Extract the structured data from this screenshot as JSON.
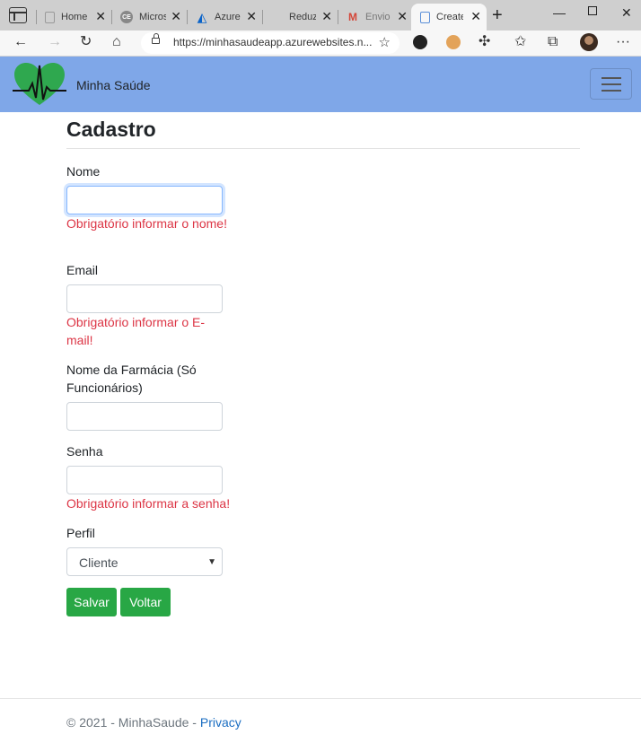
{
  "browser": {
    "tabs": [
      {
        "title": "Home"
      },
      {
        "title": "Micros"
      },
      {
        "title": "Azure"
      },
      {
        "title": "Reduz"
      },
      {
        "title": "Envio"
      },
      {
        "title": "Create"
      }
    ],
    "url": "https://minhasaudeapp.azurewebsites.n..."
  },
  "navbar": {
    "brand": "Minha Saúde"
  },
  "page": {
    "title": "Cadastro"
  },
  "form": {
    "nome": {
      "label": "Nome",
      "value": "",
      "error": "Obrigatório informar o nome!"
    },
    "email": {
      "label": "Email",
      "value": "",
      "error": "Obrigatório informar o E-mail!"
    },
    "farmacia": {
      "label": "Nome da Farmácia (Só Funcionários)",
      "value": ""
    },
    "senha": {
      "label": "Senha",
      "value": "",
      "error": "Obrigatório informar a senha!"
    },
    "perfil": {
      "label": "Perfil",
      "selected": "Cliente"
    },
    "salvar_label": "Salvar",
    "voltar_label": "Voltar"
  },
  "footer": {
    "copyright": "© 2021 - MinhaSaude - ",
    "privacy": "Privacy"
  },
  "colors": {
    "navbar": "#7fa7e8",
    "button": "#28a745",
    "error": "#dc3545",
    "link": "#1b6ec2"
  }
}
